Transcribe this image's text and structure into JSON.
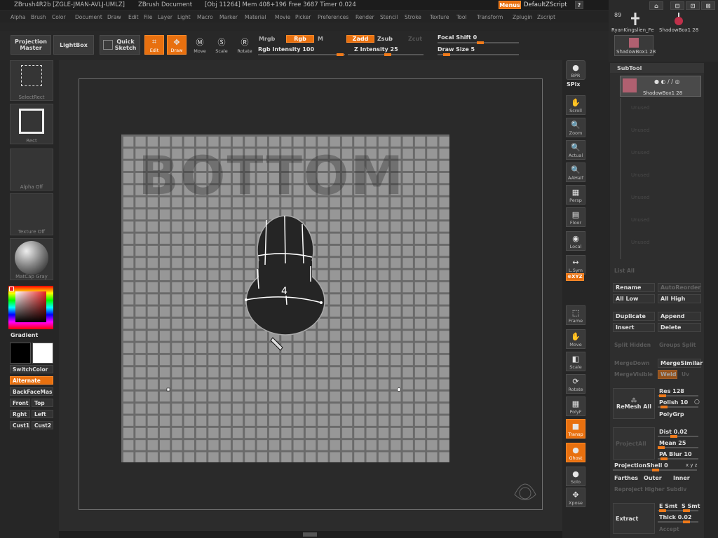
{
  "titlebar": {
    "app": "ZBrush4R2b [ZGLE-JMAN-AVLJ-UMLZ]",
    "doc": "ZBrush Document",
    "stats": "[Obj 11264] Mem 408+196 Free 3687 Timer 0.024",
    "menus_btn": "Menus",
    "script_btn": "DefaultZScript"
  },
  "menubar": [
    "Alpha",
    "Brush",
    "Color",
    "Document",
    "Draw",
    "Edit",
    "File",
    "Layer",
    "Light",
    "Macro",
    "Marker",
    "Material",
    "Movie",
    "Picker",
    "Preferences",
    "Render",
    "Stencil",
    "Stroke",
    "Texture",
    "Tool",
    "Transform",
    "Zplugin",
    "Zscript"
  ],
  "toolbar": {
    "projection_master": "Projection Master",
    "lightbox": "LightBox",
    "quick_sketch": "Quick Sketch",
    "edit": "Edit",
    "draw": "Draw",
    "move": "Move",
    "scale": "Scale",
    "rotate": "Rotate",
    "mrgb": "Mrgb",
    "rgb": "Rgb",
    "m": "M",
    "rgb_intensity": "Rgb Intensity 100",
    "zadd": "Zadd",
    "zsub": "Zsub",
    "zcut": "Zcut",
    "z_intensity": "Z Intensity 25",
    "focal_shift": "Focal Shift 0",
    "draw_size": "Draw Size 5"
  },
  "left": {
    "select_rect": "SelectRect",
    "rect": "Rect",
    "alpha_off": "Alpha Off",
    "texture_off": "Texture Off",
    "matcap": "MatCap Gray",
    "gradient": "Gradient",
    "switch_color": "SwitchColor",
    "alternate": "Alternate",
    "backface": "BackFaceMas",
    "front": "Front",
    "top": "Top",
    "right": "Rght",
    "left_btn": "Left",
    "cust1": "Cust1",
    "cust2": "Cust2"
  },
  "canvas": {
    "bottom_label": "BOTTOM",
    "sketch_number": "4"
  },
  "righttools": [
    {
      "name": "bpr",
      "label": "BPR",
      "glyph": "●"
    },
    {
      "name": "scroll",
      "label": "Scroll",
      "glyph": "✋"
    },
    {
      "name": "zoom",
      "label": "Zoom",
      "glyph": "🔍"
    },
    {
      "name": "actual",
      "label": "Actual",
      "glyph": "🔍"
    },
    {
      "name": "aahalf",
      "label": "AAHalf",
      "glyph": "🔍"
    },
    {
      "name": "persp",
      "label": "Persp",
      "glyph": "▦"
    },
    {
      "name": "floor",
      "label": "Floor",
      "glyph": "▤"
    },
    {
      "name": "local",
      "label": "Local",
      "glyph": "◉"
    },
    {
      "name": "lsym",
      "label": "L.Sym",
      "glyph": "↔"
    },
    {
      "name": "frame",
      "label": "Frame",
      "glyph": "⬚"
    },
    {
      "name": "move",
      "label": "Move",
      "glyph": "✋"
    },
    {
      "name": "scale",
      "label": "Scale",
      "glyph": "◧"
    },
    {
      "name": "rotate",
      "label": "Rotate",
      "glyph": "⟳"
    },
    {
      "name": "polyf",
      "label": "PolyF",
      "glyph": "▦"
    },
    {
      "name": "transp",
      "label": "Transp",
      "glyph": "■"
    },
    {
      "name": "ghost",
      "label": "Ghost",
      "glyph": "●"
    },
    {
      "name": "solo",
      "label": "Solo",
      "glyph": "●"
    },
    {
      "name": "xpose",
      "label": "Xpose",
      "glyph": "✥"
    }
  ],
  "spix_label": "SPix",
  "xyz_label": "⊕XYZ",
  "tool_thumbs": {
    "count": "89",
    "item1": "RyanKingslien_Fe",
    "item2": "ShadowBox1 28",
    "item3": "ShadowBox1 28"
  },
  "subtool": {
    "header": "SubTool",
    "active_item": "ShadowBox1 28",
    "empty_slots": [
      "Unused",
      "Unused",
      "Unused",
      "Unused",
      "Unused",
      "Unused",
      "Unused"
    ],
    "list_all": "List All",
    "rename": "Rename",
    "auto_reorder": "AutoReorder",
    "all_low": "All Low",
    "all_high": "All High",
    "duplicate": "Duplicate",
    "append": "Append",
    "insert": "Insert",
    "delete": "Delete",
    "split_hidden": "Split Hidden",
    "groups_split": "Groups Split",
    "merge_down": "MergeDown",
    "merge_similar": "MergeSimilar",
    "merge_visible": "MergeVisible",
    "weld": "Weld",
    "uv": "Uv",
    "remesh_all": "ReMesh All",
    "res": "Res 128",
    "polish": "Polish 10",
    "polygrp": "PolyGrp",
    "project_all": "ProjectAll",
    "dist": "Dist 0.02",
    "mean": "Mean 25",
    "pa_blur": "PA Blur 10",
    "projection_shell": "ProjectionShell 0",
    "farthest": "Farthes",
    "outer": "Outer",
    "inner": "Inner",
    "reproject": "Reproject Higher Subdiv",
    "extract": "Extract",
    "e_smt": "E Smt",
    "s_smt": "S Smt",
    "thick": "Thick 0.02",
    "accept": "Accept"
  },
  "colors": {
    "accent": "#e8700f",
    "bg": "#262626",
    "panel": "#333333"
  }
}
